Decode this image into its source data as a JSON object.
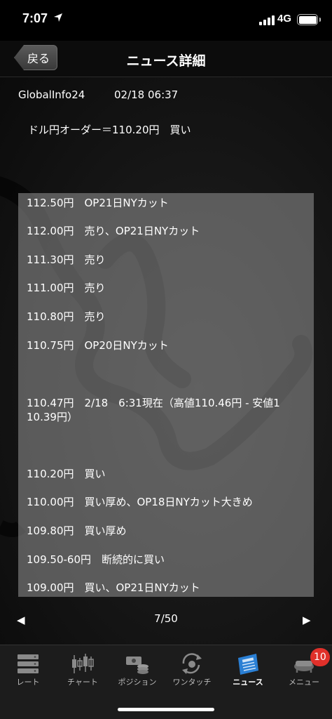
{
  "status_bar": {
    "time": "7:07",
    "network": "4G"
  },
  "nav": {
    "back_label": "戻る",
    "title": "ニュース詳細"
  },
  "article": {
    "source": "GlobalInfo24",
    "datetime": "02/18 06:37",
    "headline": "ドル円オーダー＝110.20円　買い",
    "rows": [
      "112.50円　OP21日NYカット",
      "112.00円　売り、OP21日NYカット",
      "111.30円　売り",
      "111.00円　売り",
      "110.80円　売り",
      "110.75円　OP20日NYカット",
      "110.47円　2/18　6:31現在（高値110.46円 - 安値1\n10.39円）",
      "110.20円　買い",
      "110.00円　買い厚め、OP18日NYカット大きめ",
      "109.80円　買い厚め",
      "109.50-60円　断続的に買い",
      "109.00円　買い、OP21日NYカット"
    ]
  },
  "pager": {
    "count": "7/50",
    "prev_icon": "◀",
    "next_icon": "▶"
  },
  "tabs": [
    {
      "label": "レート",
      "icon": "rate-icon"
    },
    {
      "label": "チャート",
      "icon": "chart-icon"
    },
    {
      "label": "ポジション",
      "icon": "position-icon"
    },
    {
      "label": "ワンタッチ",
      "icon": "one-touch-icon"
    },
    {
      "label": "ニュース",
      "icon": "news-icon",
      "active": true
    },
    {
      "label": "メニュー",
      "icon": "menu-icon",
      "badge": "10"
    }
  ],
  "colors": {
    "badge": "#e0302a",
    "news_icon": "#2a7fd4"
  }
}
